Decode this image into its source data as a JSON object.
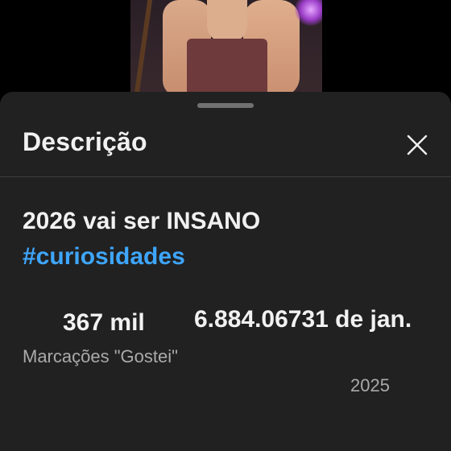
{
  "sheet": {
    "title": "Descrição",
    "close_icon": "close-icon"
  },
  "video": {
    "title": "2026 vai ser INSANO",
    "hashtag": "#curiosidades"
  },
  "stats": {
    "likes_value": "367 mil",
    "likes_label": "Marcações \"Gostei\"",
    "views_date_line": "6.884.06731 de jan.",
    "year": "2025"
  },
  "colors": {
    "sheet_bg": "#212121",
    "link": "#3ea6ff",
    "text_primary": "#f1f1f1",
    "text_secondary": "#aaaaaa"
  }
}
